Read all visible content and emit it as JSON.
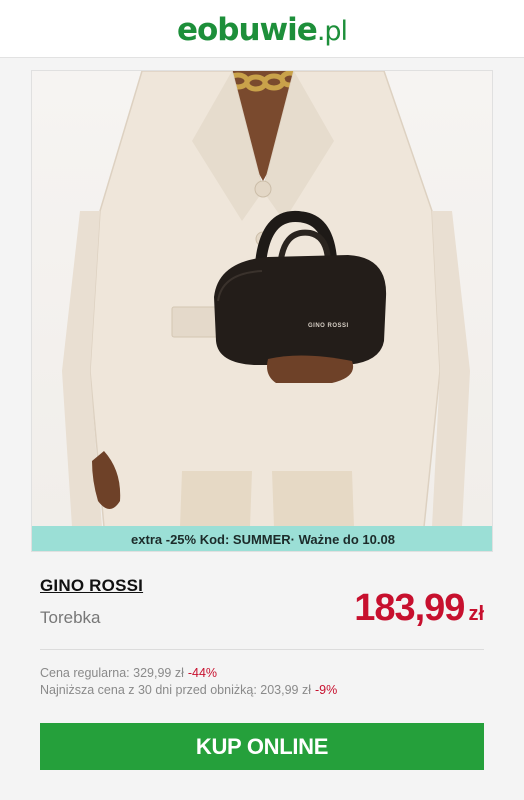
{
  "header": {
    "logo_left": "e",
    "logo_main": "obuwie",
    "logo_suffix": ".pl"
  },
  "promo": {
    "text": "extra -25% Kod: SUMMER· Ważne do 10.08"
  },
  "product": {
    "brand": "GINO ROSSI",
    "type": "Torebka",
    "price": "183,99",
    "currency": "zł",
    "bag_logo": "GINO ROSSI"
  },
  "pricing_info": {
    "regular_label": "Cena regularna: 329,99 zł",
    "regular_pct": "-44%",
    "lowest_label": "Najniższa cena z 30 dni przed obniżką: 203,99 zł",
    "lowest_pct": "-9%"
  },
  "cta": {
    "label": "KUP ONLINE"
  },
  "colors": {
    "brand_green": "#1d8f3a",
    "button_green": "#25a03b",
    "price_red": "#c7102e",
    "promo_bg": "#9bdfd6"
  }
}
